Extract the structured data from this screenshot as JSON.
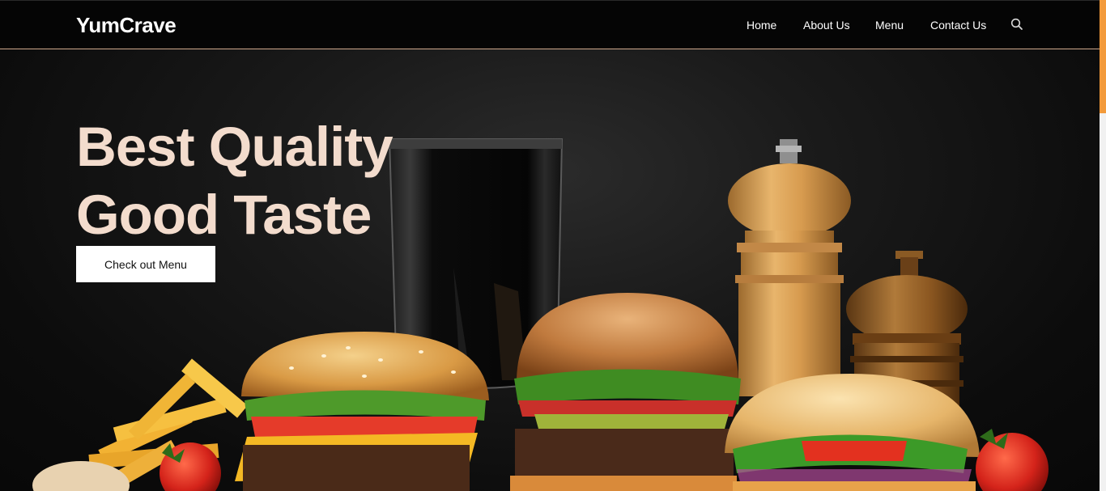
{
  "brand": {
    "name": "YumCrave"
  },
  "nav": {
    "items": [
      {
        "label": "Home"
      },
      {
        "label": "About Us"
      },
      {
        "label": "Menu"
      },
      {
        "label": "Contact Us"
      }
    ],
    "search_icon": "search-icon"
  },
  "hero": {
    "title_line1": "Best Quality",
    "title_line2": "Good Taste",
    "cta_label": "Check out Menu"
  },
  "colors": {
    "navbar_bg": "#050505",
    "nav_border": "#cfa88c",
    "hero_title": "#f3dccd",
    "scroll_thumb": "#f39a3a",
    "cta_bg": "#ffffff"
  }
}
